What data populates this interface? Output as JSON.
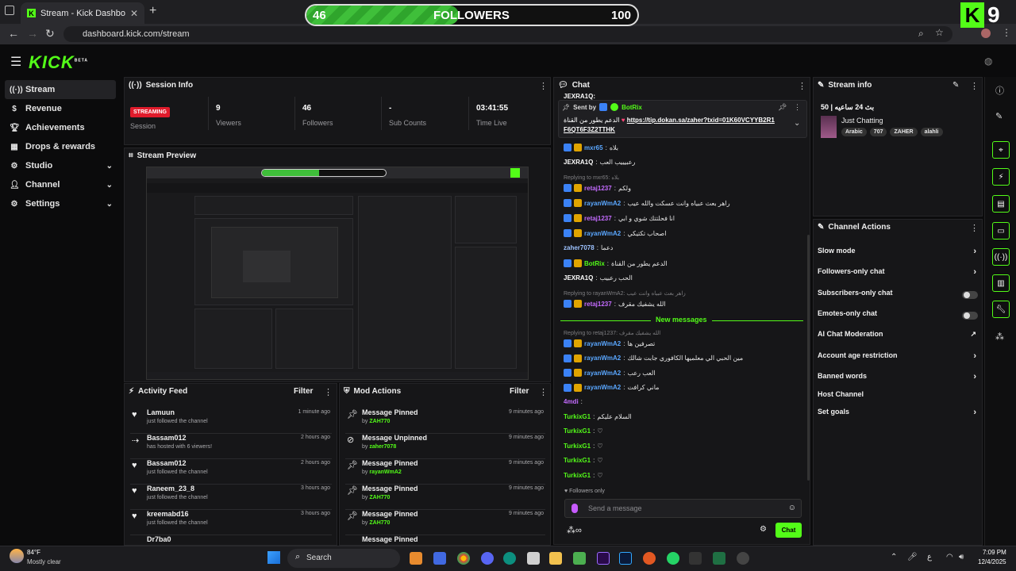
{
  "browser": {
    "tab_title": "Stream - Kick Dashboard",
    "url": "dashboard.kick.com/stream"
  },
  "overlay": {
    "current": "46",
    "label": "FOLLOWERS",
    "goal": "100",
    "progress": 0.46,
    "k_badge": "K",
    "k_number": "9"
  },
  "app": {
    "logo": "KICK",
    "logo_sup": "BETA"
  },
  "sidebar": {
    "items": [
      {
        "label": "Stream",
        "icon": "broadcast-icon"
      },
      {
        "label": "Revenue",
        "icon": "dollar-icon"
      },
      {
        "label": "Achievements",
        "icon": "trophy-icon"
      },
      {
        "label": "Drops & rewards",
        "icon": "gift-icon"
      },
      {
        "label": "Studio",
        "icon": "studio-icon"
      },
      {
        "label": "Channel",
        "icon": "user-icon"
      },
      {
        "label": "Settings",
        "icon": "gear-icon"
      }
    ]
  },
  "session": {
    "title": "Session Info",
    "status": "STREAMING",
    "status_label": "Session",
    "viewers": "9",
    "viewers_label": "Viewers",
    "followers": "46",
    "followers_label": "Followers",
    "subs": "-",
    "subs_label": "Sub Counts",
    "time": "03:41:55",
    "time_label": "Time Live"
  },
  "preview": {
    "title": "Stream Preview"
  },
  "activity": {
    "title": "Activity Feed",
    "filter": "Filter",
    "rows": [
      {
        "name": "Lamuun",
        "sub": "just followed the channel",
        "time": "1 minute ago"
      },
      {
        "name": "Bassam012",
        "sub": "has hosted with 6 viewers!",
        "time": "2 hours ago"
      },
      {
        "name": "Bassam012",
        "sub": "just followed the channel",
        "time": "2 hours ago"
      },
      {
        "name": "Raneem_23_8",
        "sub": "just followed the channel",
        "time": "3 hours ago"
      },
      {
        "name": "kreemabd16",
        "sub": "just followed the channel",
        "time": "3 hours ago"
      },
      {
        "name": "Dr7ba0",
        "sub": "",
        "time": ""
      }
    ]
  },
  "mod": {
    "title": "Mod Actions",
    "filter": "Filter",
    "rows": [
      {
        "title": "Message Pinned",
        "by": "by",
        "user": "ZAH770",
        "time": "9 minutes ago"
      },
      {
        "title": "Message Unpinned",
        "by": "by",
        "user": "zaher7078",
        "time": "9 minutes ago"
      },
      {
        "title": "Message Pinned",
        "by": "by",
        "user": "rayanWmA2",
        "time": "9 minutes ago"
      },
      {
        "title": "Message Pinned",
        "by": "by",
        "user": "ZAH770",
        "time": "9 minutes ago"
      },
      {
        "title": "Message Pinned",
        "by": "by",
        "user": "ZAH770",
        "time": "9 minutes ago"
      },
      {
        "title": "Message Pinned",
        "by": "",
        "user": "",
        "time": ""
      }
    ]
  },
  "chat": {
    "title": "Chat",
    "pinned_top": "JEXRA1Q:",
    "pinned_sent_by": "Sent by",
    "pinned_user": "BotRix",
    "pinned_text": "الدعم يطور من القناة",
    "pinned_link": "https://tip.dokan.sa/zaher?txid=01K60VCYYB2R1F6QT6F3Z2TTHK",
    "lines": [
      {
        "user": "mxr65",
        "color": "#5aa7ff",
        "text": "بلاه"
      },
      {
        "user": "JEXRA1Q",
        "color": "#ffffff",
        "text": "رعبيييب العب"
      },
      {
        "reply": "Replying to mxr65: بلاه"
      },
      {
        "user": "retaj1237",
        "color": "#c46bff",
        "text": "ولكم"
      },
      {
        "user": "rayanWmA2",
        "color": "#5aa7ff",
        "text": "راهر بعث عبياه وانت عسكت والله عيب"
      },
      {
        "user": "retaj1237",
        "color": "#c46bff",
        "text": "انا فحلتتك شوي و ابي"
      },
      {
        "user": "rayanWmA2",
        "color": "#5aa7ff",
        "text": "اصحاب تكتيكي"
      },
      {
        "user": "zaher7078",
        "color": "#9ec3ff",
        "text": "دعما"
      },
      {
        "user": "BotRix",
        "color": "#53fc18",
        "text": "الدعم يطور من القناة"
      },
      {
        "user": "JEXRA1Q",
        "color": "#ffffff",
        "text": "الحب رعبيب"
      },
      {
        "reply": "Replying to rayanWmA2: زاهر بعث عبياه وانت عيب"
      },
      {
        "user": "retaj1237",
        "color": "#c46bff",
        "text": "الله يشفيك مقرف"
      }
    ],
    "new_messages": "New messages",
    "lines2": [
      {
        "reply": "Replying to retaj1237: الله يشفيك مقرف"
      },
      {
        "user": "rayanWmA2",
        "color": "#5aa7ff",
        "text": "تصرفين ها"
      },
      {
        "user": "rayanWmA2",
        "color": "#5aa7ff",
        "text": "مين الحبي الي معلميها الكافوري جابت شالك"
      },
      {
        "user": "rayanWmA2",
        "color": "#5aa7ff",
        "text": "العب رعب"
      },
      {
        "user": "rayanWmA2",
        "color": "#5aa7ff",
        "text": "ماني كرافت"
      },
      {
        "user": "4mdi",
        "color": "#c46bff",
        "text": ""
      },
      {
        "user": "TurkixG1",
        "color": "#53fc18",
        "text": "السلام عليكم"
      },
      {
        "user": "TurkixG1",
        "color": "#53fc18",
        "text": "♡"
      },
      {
        "user": "TurkixG1",
        "color": "#53fc18",
        "text": "♡"
      },
      {
        "user": "TurkixG1",
        "color": "#53fc18",
        "text": "♡"
      },
      {
        "user": "TurkixG1",
        "color": "#53fc18",
        "text": "♡"
      }
    ],
    "followers_only": "Followers only",
    "input_placeholder": "Send a message",
    "send_label": "Chat"
  },
  "stream_info": {
    "title": "Stream info",
    "stream_title": "50 | بث 24 ساعيه",
    "category": "Just Chatting",
    "tags": [
      "Arabic",
      "707",
      "ZAHER",
      "alahli"
    ]
  },
  "channel_actions": {
    "title": "Channel Actions",
    "rows": [
      {
        "label": "Slow mode",
        "ctrl": "chevron"
      },
      {
        "label": "Followers-only chat",
        "ctrl": "chevron"
      },
      {
        "label": "Subscribers-only chat",
        "ctrl": "toggle"
      },
      {
        "label": "Emotes-only chat",
        "ctrl": "toggle"
      },
      {
        "label": "AI Chat Moderation",
        "ctrl": "external"
      },
      {
        "label": "Account age restriction",
        "ctrl": "chevron"
      },
      {
        "label": "Banned words",
        "ctrl": "chevron"
      },
      {
        "label": "Host Channel",
        "ctrl": "none"
      },
      {
        "label": "Set goals",
        "ctrl": "chevron"
      }
    ]
  },
  "taskbar": {
    "weather_temp": "84°F",
    "weather_desc": "Mostly clear",
    "search": "Search",
    "time": "7:09 PM",
    "date": "12/4/2025"
  }
}
